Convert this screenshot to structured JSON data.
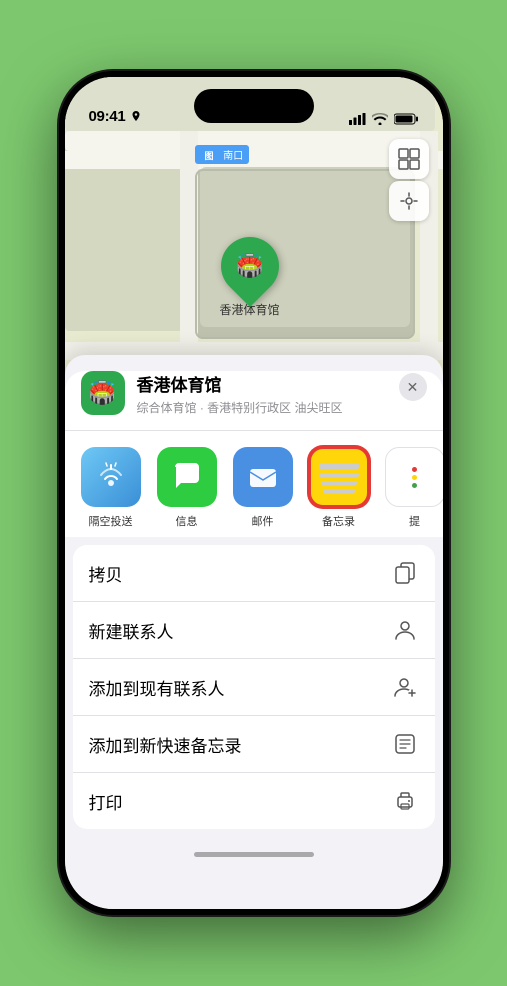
{
  "status": {
    "time": "09:41",
    "location_arrow": true
  },
  "map": {
    "label": "南口",
    "pin_venue": "香港体育馆"
  },
  "location_card": {
    "name": "香港体育馆",
    "subtitle": "综合体育馆 · 香港特别行政区 油尖旺区",
    "close_label": "×"
  },
  "share_items": [
    {
      "id": "airdrop",
      "label": "隔空投送"
    },
    {
      "id": "messages",
      "label": "信息"
    },
    {
      "id": "mail",
      "label": "邮件"
    },
    {
      "id": "notes",
      "label": "备忘录"
    },
    {
      "id": "more",
      "label": "提"
    }
  ],
  "actions": [
    {
      "label": "拷贝",
      "icon": "copy"
    },
    {
      "label": "新建联系人",
      "icon": "person"
    },
    {
      "label": "添加到现有联系人",
      "icon": "person-add"
    },
    {
      "label": "添加到新快速备忘录",
      "icon": "note"
    },
    {
      "label": "打印",
      "icon": "print"
    }
  ]
}
